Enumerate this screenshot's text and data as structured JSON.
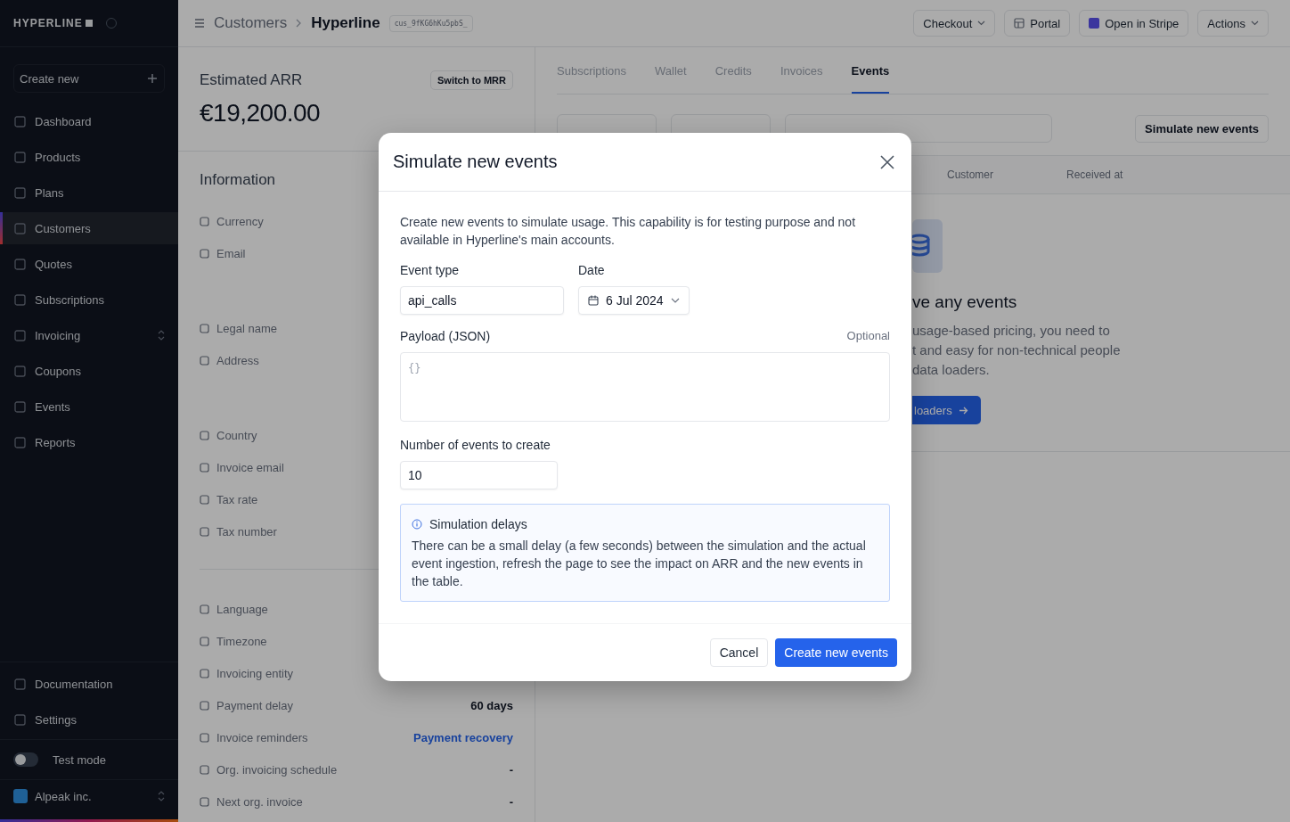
{
  "sidebar": {
    "logo": "HYPERLINE",
    "create_button": "Create new",
    "items": [
      {
        "label": "Dashboard",
        "selected": false,
        "has_submenu": false
      },
      {
        "label": "Products",
        "selected": false,
        "has_submenu": false
      },
      {
        "label": "Plans",
        "selected": false,
        "has_submenu": false
      },
      {
        "label": "Customers",
        "selected": true,
        "has_submenu": false
      },
      {
        "label": "Quotes",
        "selected": false,
        "has_submenu": false
      },
      {
        "label": "Subscriptions",
        "selected": false,
        "has_submenu": false
      },
      {
        "label": "Invoicing",
        "selected": false,
        "has_submenu": true
      },
      {
        "label": "Coupons",
        "selected": false,
        "has_submenu": false
      },
      {
        "label": "Events",
        "selected": false,
        "has_submenu": false
      },
      {
        "label": "Reports",
        "selected": false,
        "has_submenu": false
      }
    ],
    "bottom_items": [
      {
        "label": "Documentation"
      },
      {
        "label": "Settings"
      }
    ],
    "test_mode": {
      "label": "Test mode",
      "on": false
    },
    "account": {
      "name": "Alpeak inc."
    }
  },
  "breadcrumb": {
    "parent": "Customers",
    "current": "Hyperline",
    "id_badge": "cus_9fKG6hKu5pbS_"
  },
  "header_buttons": [
    {
      "label": "Checkout",
      "kind": "dropdown"
    },
    {
      "label": "Portal",
      "kind": "portal"
    },
    {
      "label": "Open in Stripe",
      "kind": "stripe"
    },
    {
      "label": "Actions",
      "kind": "dropdown"
    }
  ],
  "summary": {
    "title": "Estimated ARR",
    "switch_button": "Switch to MRR",
    "amount": "€19,200.00"
  },
  "information": {
    "title": "Information",
    "groups": [
      [
        {
          "label": "Currency"
        },
        {
          "label": "Email"
        }
      ],
      [
        {
          "label": "Legal name"
        },
        {
          "label": "Address"
        }
      ],
      [
        {
          "label": "Country"
        },
        {
          "label": "Invoice email"
        },
        {
          "label": "Tax rate"
        },
        {
          "label": "Tax number"
        }
      ],
      [
        {
          "label": "Language"
        },
        {
          "label": "Timezone"
        },
        {
          "label": "Invoicing entity"
        },
        {
          "label": "Payment delay",
          "value": "60 days",
          "kind": "text"
        },
        {
          "label": "Invoice reminders",
          "value": "Payment recovery",
          "kind": "link"
        },
        {
          "label": "Org. invoicing schedule",
          "value": "-",
          "kind": "text"
        },
        {
          "label": "Next org. invoice",
          "value": "-",
          "kind": "text"
        }
      ]
    ]
  },
  "tabs": [
    {
      "label": "Subscriptions",
      "selected": false
    },
    {
      "label": "Wallet",
      "selected": false
    },
    {
      "label": "Credits",
      "selected": false
    },
    {
      "label": "Invoices",
      "selected": false
    },
    {
      "label": "Events",
      "selected": true
    }
  ],
  "events_toolbar": {
    "simulate_button": "Simulate new events"
  },
  "table": {
    "columns": [
      "Customer",
      "Received at"
    ]
  },
  "empty_state": {
    "title": "ve any events",
    "lines": [
      "usage-based pricing, you need to",
      "t and easy for non-technical people",
      "data loaders."
    ],
    "button": "loaders"
  },
  "modal": {
    "title": "Simulate new events",
    "description": "Create new events to simulate usage. This capability is for testing purpose and not available in Hyperline's main accounts.",
    "event_type": {
      "label": "Event type",
      "value": "api_calls"
    },
    "date": {
      "label": "Date",
      "value": "6 Jul 2024"
    },
    "payload": {
      "label": "Payload (JSON)",
      "hint": "Optional",
      "placeholder": "{}"
    },
    "count": {
      "label": "Number of events to create",
      "value": "10"
    },
    "notice": {
      "title": "Simulation delays",
      "text": "There can be a small delay (a few seconds) between the simulation and the actual event ingestion, refresh the page to see the impact on ARR and the new events in the table."
    },
    "cancel_button": "Cancel",
    "submit_button": "Create new events"
  }
}
